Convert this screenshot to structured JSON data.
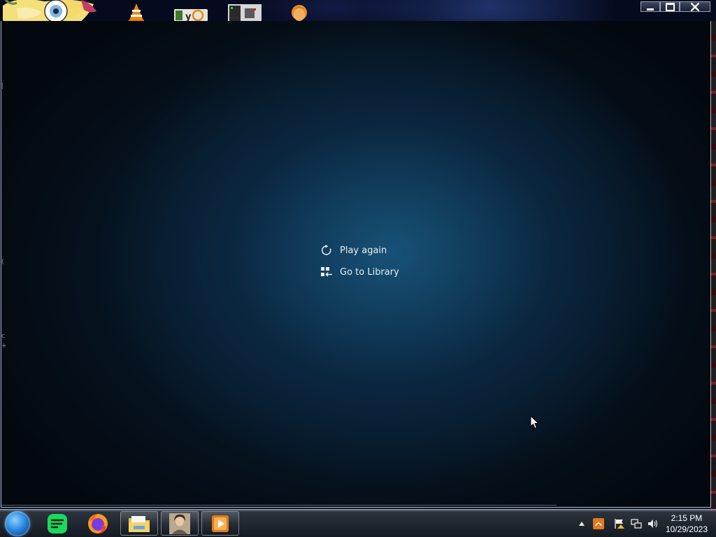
{
  "menu": {
    "play_again_label": "Play again",
    "go_to_library_label": "Go to Library"
  },
  "window": {
    "controls": [
      "minimize-icon",
      "maximize-icon",
      "close-icon"
    ]
  },
  "desktop_icons": [
    "anime-character-icon",
    "vlc-icon",
    "lyd-app-icon",
    "gray-app-icon",
    "head-avatar-icon"
  ],
  "taskbar": {
    "pinned": [
      "start-orb",
      "spotify-icon",
      "firefox-icon",
      "file-explorer-icon",
      "portrait-app-icon",
      "media-player-icon"
    ],
    "tray_icons": [
      "show-hidden-icons-arrow",
      "app-tray-icon",
      "action-center-flag-icon",
      "network-icon",
      "volume-icon"
    ],
    "clock_time": "2:15 PM",
    "clock_date": "10/29/2023"
  },
  "colors": {
    "menu_text": "#e8eef4",
    "app_background_center": "#18547a",
    "spotify_green": "#1ed760"
  }
}
